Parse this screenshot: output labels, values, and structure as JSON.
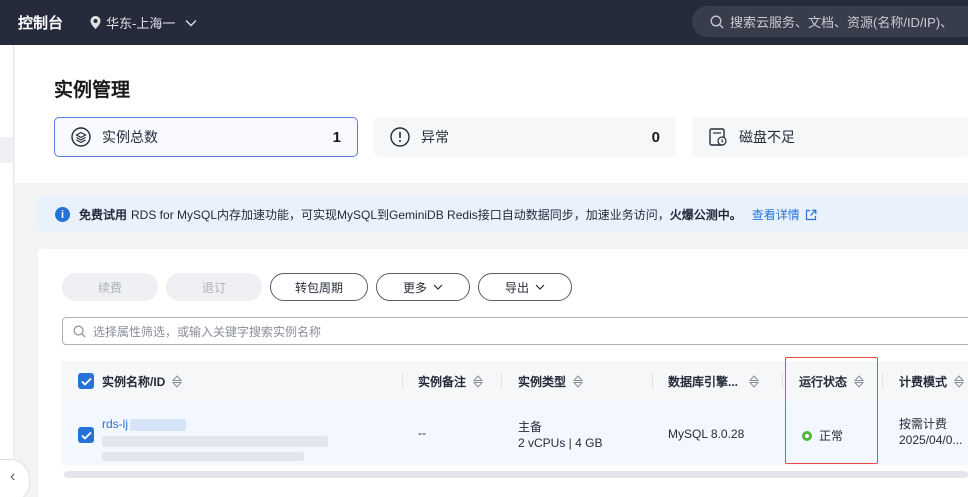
{
  "topbar": {
    "brand": "控制台",
    "region": "华东-上海一",
    "search_placeholder": "搜索云服务、文档、资源(名称/ID/IP)、"
  },
  "page": {
    "title": "实例管理"
  },
  "stats": [
    {
      "label": "实例总数",
      "count": "1",
      "icon": "instances-icon",
      "active": true
    },
    {
      "label": "异常",
      "count": "0",
      "icon": "alert-icon",
      "active": false
    },
    {
      "label": "磁盘不足",
      "count": "",
      "icon": "disk-icon",
      "active": false
    }
  ],
  "banner": {
    "tag": "免费试用",
    "text": "RDS for MySQL内存加速功能，可实现MySQL到GeminiDB Redis接口自动数据同步，加速业务访问，",
    "hot": "火爆公测中。",
    "link": "查看详情"
  },
  "toolbar": {
    "renew": "续费",
    "unsubscribe": "退订",
    "to_package": "转包周期",
    "more": "更多",
    "export": "导出"
  },
  "filter": {
    "placeholder": "选择属性筛选，或输入关键字搜索实例名称"
  },
  "table": {
    "columns": [
      "实例名称/ID",
      "实例备注",
      "实例类型",
      "数据库引擎...",
      "运行状态",
      "计费模式"
    ],
    "rows": [
      {
        "name": "rds-lj",
        "remark": "--",
        "type_main": "主备",
        "type_spec": "2 vCPUs | 4 GB",
        "engine": "MySQL 8.0.28",
        "status": "正常",
        "billing": "按需计费",
        "billing_date": "2025/04/0..."
      }
    ]
  },
  "colors": {
    "topbar": "#252b3a",
    "accent": "#2673d8",
    "status_ok": "#50b83c",
    "highlight": "#e84b4b"
  }
}
